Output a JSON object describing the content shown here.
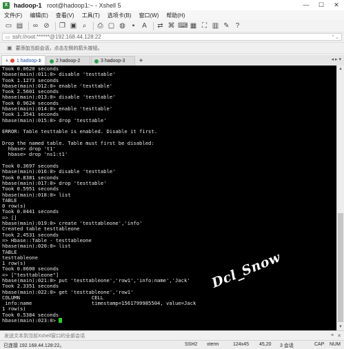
{
  "window": {
    "app_title": "hadoop-1",
    "subtitle": "root@hadoop1:~ - Xshell 5",
    "buttons": {
      "minimize": "—",
      "maximize": "☐",
      "close": "✕"
    }
  },
  "menu": [
    "文件(F)",
    "编辑(E)",
    "查看(V)",
    "工具(T)",
    "选项卡(B)",
    "窗口(W)",
    "帮助(H)"
  ],
  "address": {
    "text": "ssh://root:******@192.168.44.128:22"
  },
  "hint": {
    "text": "要添加当前会话，点击左侧的箭头按钮。"
  },
  "tabs": [
    {
      "label": "1 hadoop-1",
      "active": true
    },
    {
      "label": "2 hadoop-2",
      "active": false
    },
    {
      "label": "3 hadoop-3",
      "active": false
    }
  ],
  "tab_add": "+",
  "terminal": {
    "lines": [
      "Took 0.0620 seconds",
      "hbase(main):011:0> disable 'testtable'",
      "Took 1.1273 seconds",
      "hbase(main):012:0> enable 'testtable'",
      "Took 2.5601 seconds",
      "hbase(main):013:0> disable 'testtable'",
      "Took 0.9624 seconds",
      "hbase(main):014:0> enable 'testtable'",
      "Took 1.3541 seconds",
      "hbase(main):015:0> drop 'testtable'",
      "",
      "ERROR: Table testtable is enabled. Disable it first.",
      "",
      "Drop the named table. Table must first be disabled:",
      "  hbase> drop 't1'",
      "  hbase> drop 'ns1:t1'",
      "",
      "Took 0.3697 seconds",
      "hbase(main):016:0> disable 'testtable'",
      "Took 0.8381 seconds",
      "hbase(main):017:0> drop 'testtable'",
      "Took 0.5951 seconds",
      "hbase(main):018:0> list",
      "TABLE",
      "0 row(s)",
      "Took 0.0441 seconds",
      "=> []",
      "hbase(main):019:0> create 'testtableone','info'",
      "Created table testtableone",
      "Took 2.4531 seconds",
      "=> Hbase::Table - testtableone",
      "hbase(main):020:0> list",
      "TABLE",
      "testtableone",
      "1 row(s)",
      "Took 0.0600 seconds",
      "=> [\"testtableone\"]",
      "hbase(main):021:0> put 'testtableone','row1','info:name','Jack'",
      "Took 2.3351 seconds",
      "hbase(main):022:0> get 'testtableone','row1'",
      "COLUMN                        CELL",
      " info:name                    timestamp=1561799985504, value=Jack",
      "1 row(s)",
      "Took 0.5384 seconds"
    ],
    "prompt": "hbase(main):023:0> "
  },
  "watermark": "Dcl_Snow",
  "input_bar": {
    "placeholder": "发送文本到当前Xshell窗口的全部会话"
  },
  "status": {
    "connection": "已连接 192.168.44.128:22。",
    "protocol": "SSH2",
    "terminal_type": "xterm",
    "size": "124x45",
    "cursor_pos": "45,20",
    "sessions": "3 会话",
    "caps": "CAP",
    "num": "NUM"
  }
}
